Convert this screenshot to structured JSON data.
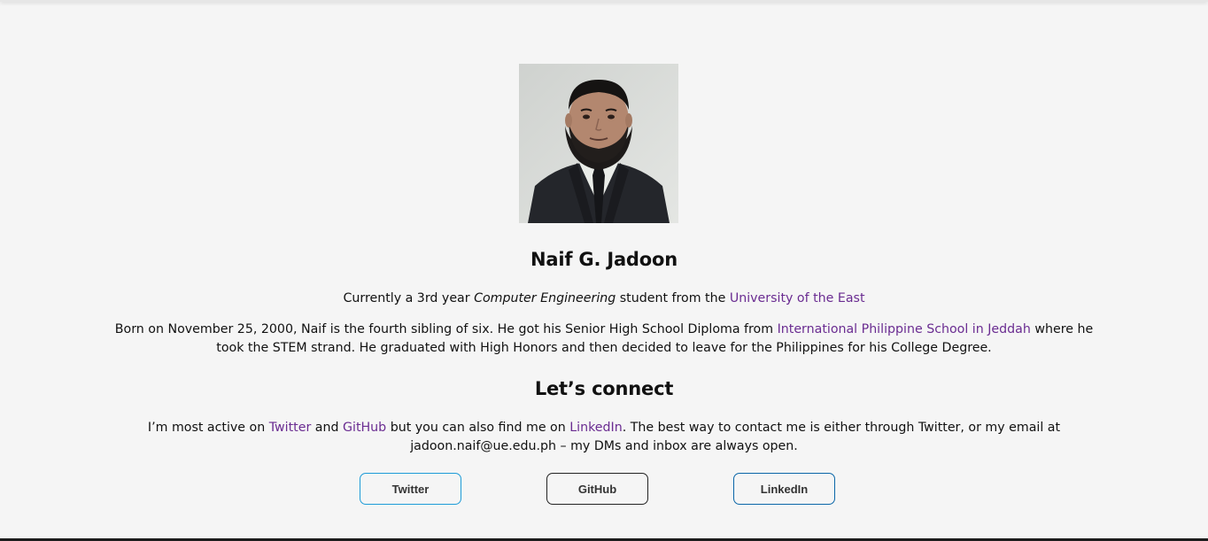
{
  "profile": {
    "photo_alt": "Naif G. Jadoon",
    "name": "Naif G. Jadoon",
    "tagline": {
      "prefix": "Currently a 3rd year ",
      "major": "Computer Engineering",
      "middle": " student from the ",
      "school_link": "University of the East"
    },
    "bio": {
      "part1": "Born on November 25, 2000, Naif is the fourth sibling of six. He got his Senior High School Diploma from ",
      "school_link": "International Philippine School in Jeddah",
      "part2": " where he took the STEM strand. He graduated with High Honors and then decided to leave for the Philippines for his College Degree."
    }
  },
  "connect": {
    "title": "Let’s connect",
    "text": {
      "part1": "I’m most active on ",
      "twitter_link": "Twitter",
      "part2": " and ",
      "github_link": "GitHub",
      "part3": " but you can also find me on ",
      "linkedin_link": "LinkedIn",
      "part4": ". The best way to contact me is either through Twitter, or my email at jadoon.naif@ue.edu.ph – my DMs and inbox are always open."
    },
    "buttons": {
      "twitter": "Twitter",
      "github": "GitHub",
      "linkedin": "LinkedIn"
    }
  },
  "colors": {
    "background": "#f5f5f5",
    "link": "#6a2c91",
    "twitter_border": "#1d9bd8",
    "github_border": "#222222",
    "linkedin_border": "#0a66a8"
  }
}
